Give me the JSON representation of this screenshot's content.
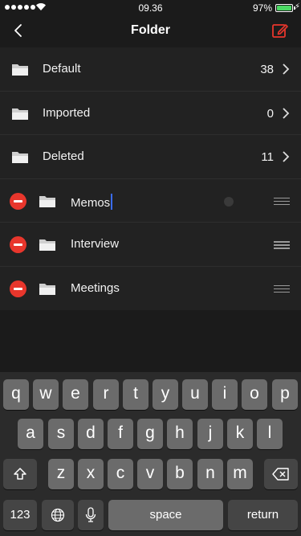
{
  "status_bar": {
    "time": "09.36",
    "battery": "97%",
    "signal_bars": 5
  },
  "nav": {
    "title": "Folder",
    "back_icon": "chevron-left-icon",
    "edit_icon": "edit-icon"
  },
  "colors": {
    "background": "#1b1b1b",
    "list_bg": "#222222",
    "delete": "#e8362c",
    "edit_accent": "#e8362c",
    "caret": "#3a6cf2",
    "key": "#6b6b6b",
    "key_dark": "#454545"
  },
  "system_folders": [
    {
      "name": "Default",
      "count": "38"
    },
    {
      "name": "Imported",
      "count": "0"
    },
    {
      "name": "Deleted",
      "count": "11"
    }
  ],
  "custom_folders": [
    {
      "name": "Memos",
      "editing": true
    },
    {
      "name": "Interview"
    },
    {
      "name": "Meetings"
    }
  ],
  "keyboard": {
    "row1": [
      "q",
      "w",
      "e",
      "r",
      "t",
      "y",
      "u",
      "i",
      "o",
      "p"
    ],
    "row2": [
      "a",
      "s",
      "d",
      "f",
      "g",
      "h",
      "j",
      "k",
      "l"
    ],
    "row3": [
      "z",
      "x",
      "c",
      "v",
      "b",
      "n",
      "m"
    ],
    "numbers_key": "123",
    "space_key": "space",
    "return_key": "return"
  }
}
